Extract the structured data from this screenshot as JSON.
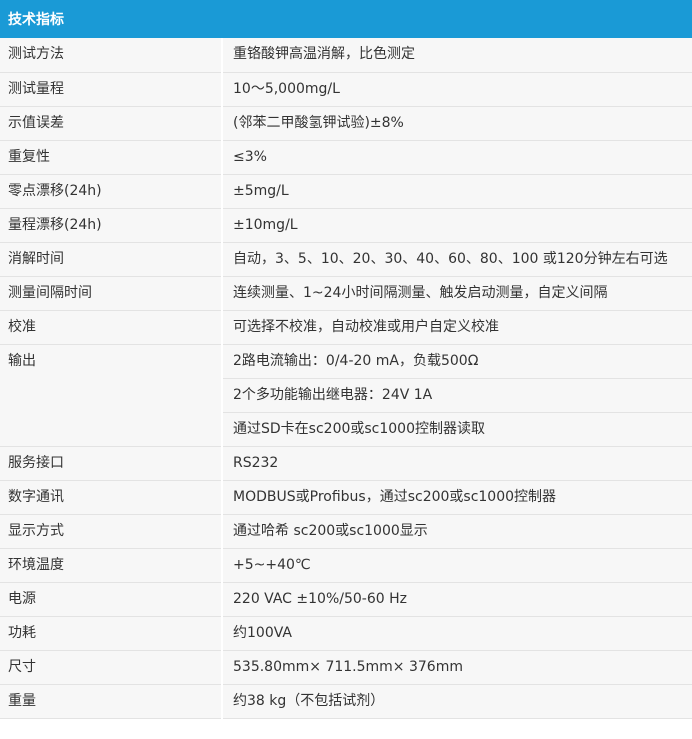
{
  "table": {
    "header": "技术指标",
    "rows": [
      {
        "label": "测试方法",
        "values": [
          "重铬酸钾高温消解，比色测定"
        ]
      },
      {
        "label": "测试量程",
        "values": [
          "10～5,000mg/L"
        ]
      },
      {
        "label": "示值误差",
        "values": [
          "(邻苯二甲酸氢钾试验)±8%"
        ]
      },
      {
        "label": "重复性",
        "values": [
          "≤3%"
        ]
      },
      {
        "label": "零点漂移(24h)",
        "values": [
          "±5mg/L"
        ]
      },
      {
        "label": "量程漂移(24h)",
        "values": [
          "±10mg/L"
        ]
      },
      {
        "label": "消解时间",
        "values": [
          "自动，3、5、10、20、30、40、60、80、100 或120分钟左右可选"
        ]
      },
      {
        "label": "测量间隔时间",
        "values": [
          "连续测量、1~24小时间隔测量、触发启动测量，自定义间隔"
        ]
      },
      {
        "label": "校准",
        "values": [
          "可选择不校准，自动校准或用户自定义校准"
        ]
      },
      {
        "label": "输出",
        "values": [
          "2路电流输出：0/4-20 mA，负载500Ω",
          "2个多功能输出继电器：24V 1A",
          "通过SD卡在sc200或sc1000控制器读取"
        ]
      },
      {
        "label": "服务接口",
        "values": [
          "RS232"
        ]
      },
      {
        "label": "数字通讯",
        "values": [
          "MODBUS或Profibus，通过sc200或sc1000控制器"
        ]
      },
      {
        "label": "显示方式",
        "values": [
          "通过哈希 sc200或sc1000显示"
        ]
      },
      {
        "label": "环境温度",
        "values": [
          "+5~+40℃"
        ]
      },
      {
        "label": "电源",
        "values": [
          "220 VAC ±10%/50-60 Hz"
        ]
      },
      {
        "label": "功耗",
        "values": [
          "约100VA"
        ]
      },
      {
        "label": "尺寸",
        "values": [
          "535.80mm× 711.5mm× 376mm"
        ]
      },
      {
        "label": "重量",
        "values": [
          "约38 kg（不包括试剂）"
        ]
      }
    ]
  }
}
